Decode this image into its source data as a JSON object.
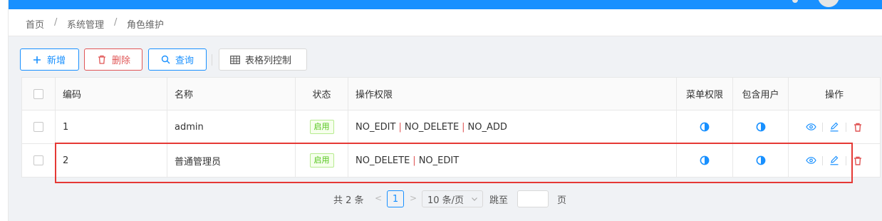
{
  "breadcrumb": [
    {
      "label": "首页"
    },
    {
      "label": "系统管理"
    },
    {
      "label": "角色维护"
    }
  ],
  "breadcrumb_separator": "/",
  "toolbar": {
    "add_label": "新增",
    "delete_label": "删除",
    "query_label": "查询",
    "columns_label": "表格列控制"
  },
  "table": {
    "headers": {
      "code": "编码",
      "name": "名称",
      "status": "状态",
      "permissions": "操作权限",
      "menu_perm": "菜单权限",
      "users": "包含用户",
      "ops": "操作"
    },
    "rows": [
      {
        "code": "1",
        "name": "admin",
        "status": "启用",
        "permissions": [
          "NO_EDIT",
          "NO_DELETE",
          "NO_ADD"
        ]
      },
      {
        "code": "2",
        "name": "普通管理员",
        "status": "启用",
        "permissions": [
          "NO_DELETE",
          "NO_EDIT"
        ]
      }
    ],
    "permission_separator": "|"
  },
  "pagination": {
    "total_text": "共 2 条",
    "current_page": "1",
    "page_size": "10 条/页",
    "jump_label": "跳至",
    "page_suffix": "页",
    "prev_arrow": "<",
    "next_arrow": ">"
  },
  "colors": {
    "primary": "#1890ff",
    "danger": "#e05656",
    "success": "#52c41a",
    "highlight": "#e53935"
  }
}
